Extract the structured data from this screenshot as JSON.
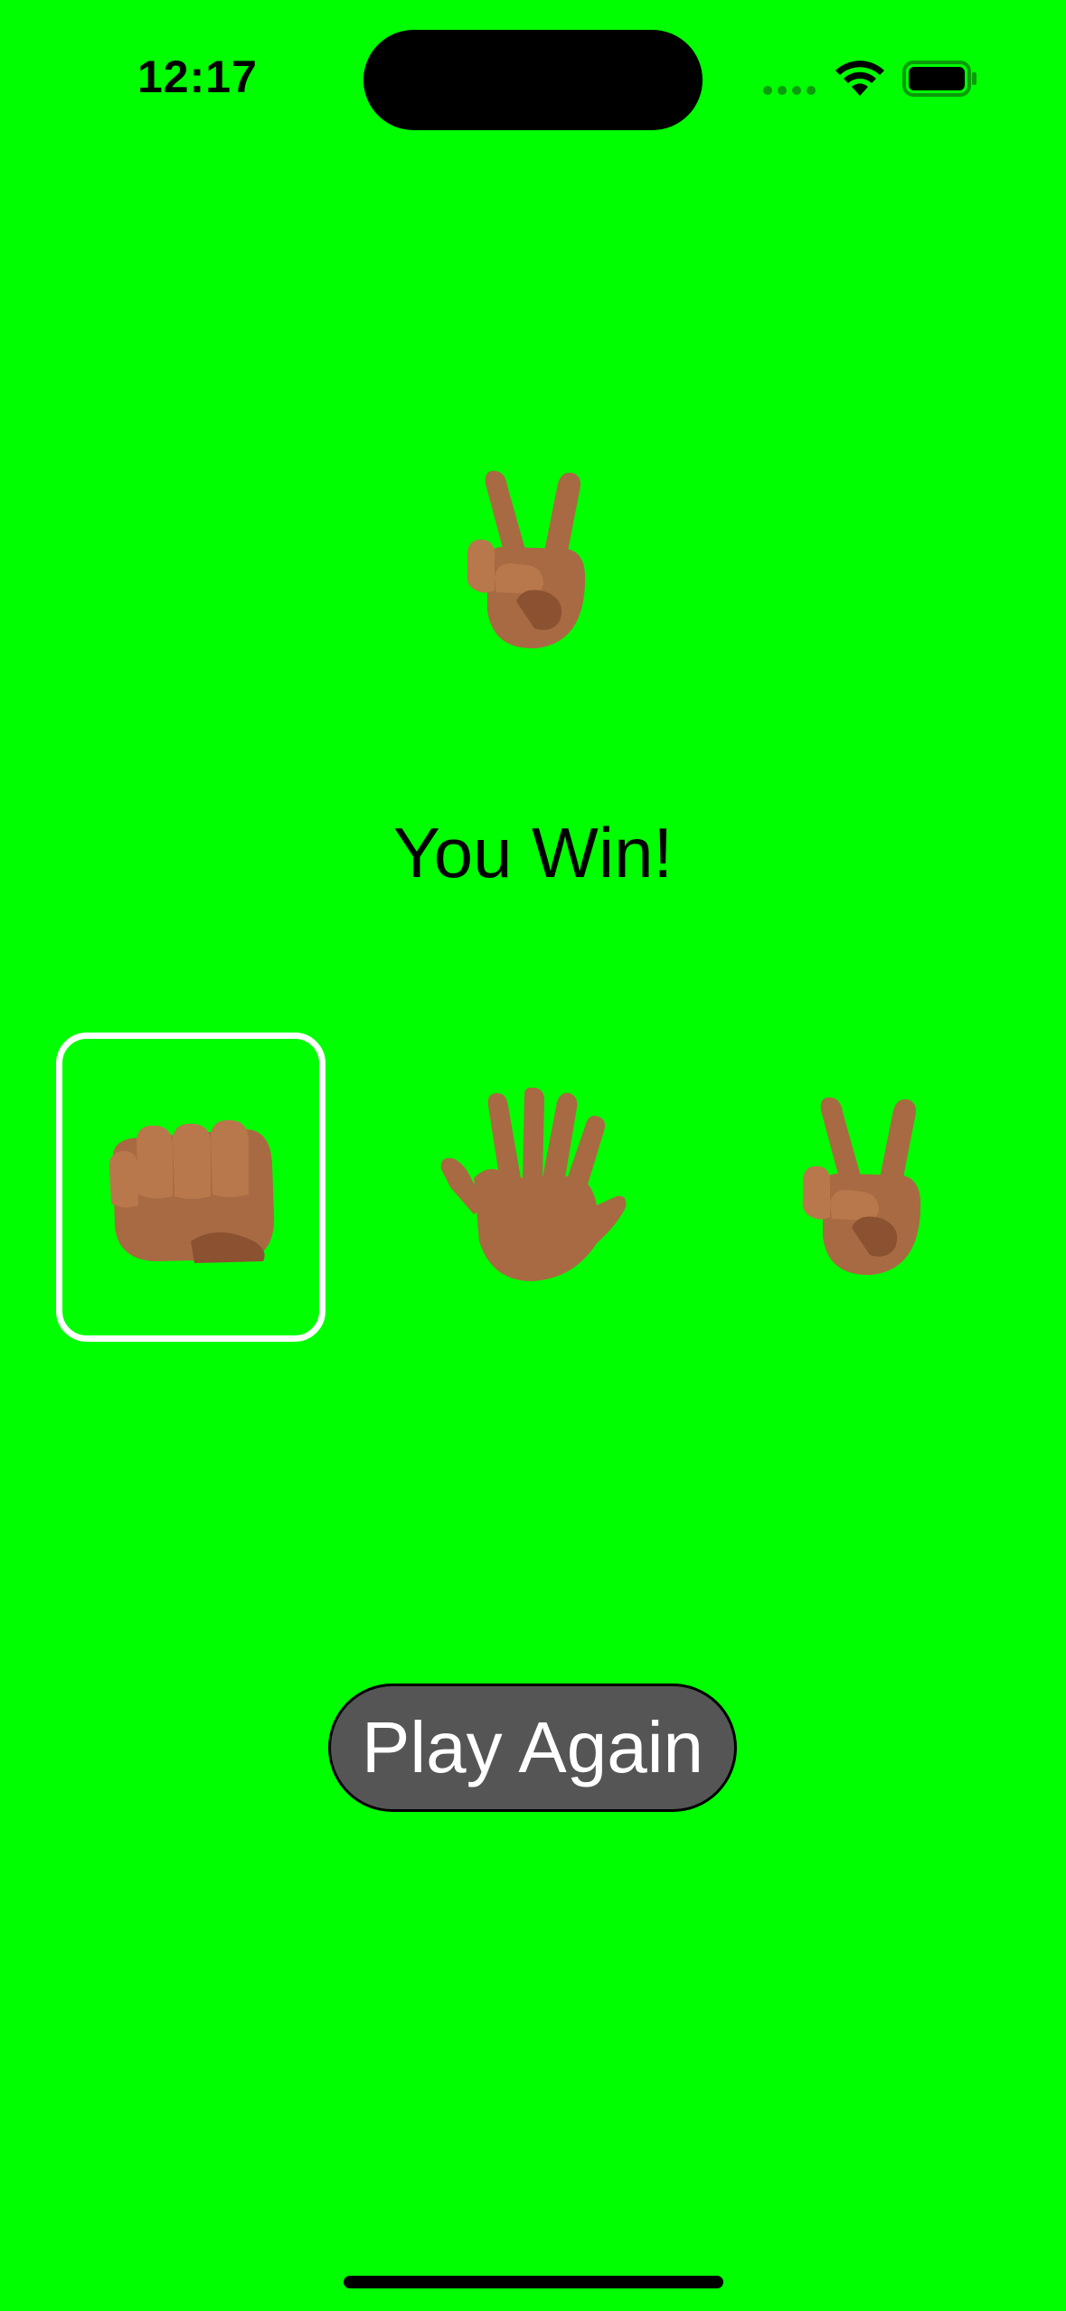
{
  "status_bar": {
    "time": "12:17",
    "icons": [
      "signal-dots-icon",
      "wifi-icon",
      "battery-icon"
    ]
  },
  "game": {
    "computer_choice": "scissors",
    "result": "You Win!",
    "choices": [
      {
        "name": "rock",
        "selected": true
      },
      {
        "name": "paper",
        "selected": false
      },
      {
        "name": "scissors",
        "selected": false
      }
    ],
    "play_again_label": "Play Again"
  },
  "colors": {
    "background": "#00FF00",
    "button": "#555555",
    "selection_border": "#FFFFFF",
    "skin": "#A86A42"
  }
}
